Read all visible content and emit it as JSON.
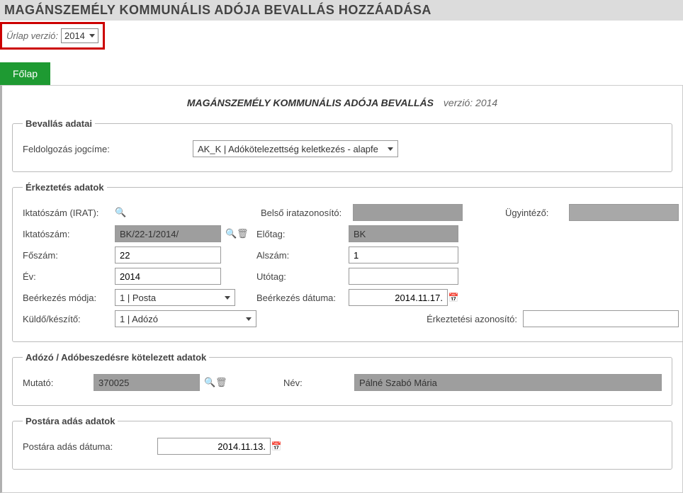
{
  "header": {
    "title": "MAGÁNSZEMÉLY KOMMUNÁLIS ADÓJA BEVALLÁS HOZZÁADÁSA"
  },
  "version": {
    "label": "Űrlap verzió:",
    "value": "2014"
  },
  "tab": {
    "main": "Főlap"
  },
  "formTitle": {
    "bold": "MAGÁNSZEMÉLY KOMMUNÁLIS ADÓJA BEVALLÁS",
    "muted": "verzió: 2014"
  },
  "bevallas": {
    "legend": "Bevallás adatai",
    "jogcim_label": "Feldolgozás jogcíme:",
    "jogcim_value": "AK_K | Adókötelezettség keletkezés - alapfe"
  },
  "erkeztetes": {
    "legend": "Érkeztetés adatok",
    "iktatoszam_irat_label": "Iktatószám (IRAT):",
    "belso_label": "Belső iratazonosító:",
    "ugyintezo_label": "Ügyintéző:",
    "iktatoszam_label": "Iktatószám:",
    "iktatoszam_value": "BK/22-1/2014/",
    "elotag_label": "Előtag:",
    "elotag_value": "BK",
    "foszam_label": "Főszám:",
    "foszam_value": "22",
    "alszam_label": "Alszám:",
    "alszam_value": "1",
    "ev_label": "Év:",
    "ev_value": "2014",
    "utotag_label": "Utótag:",
    "utotag_value": "",
    "beerkezes_mod_label": "Beérkezés módja:",
    "beerkezes_mod_value": "1 | Posta",
    "beerkezes_dat_label": "Beérkezés dátuma:",
    "beerkezes_dat_value": "2014.11.17.",
    "kuldo_label": "Küldő/készítő:",
    "kuldo_value": "1 | Adózó",
    "erkezt_azon_label": "Érkeztetési azonosító:",
    "erkezt_azon_value": ""
  },
  "adozo": {
    "legend": "Adózó / Adóbeszedésre kötelezett adatok",
    "mutato_label": "Mutató:",
    "mutato_value": "370025",
    "nev_label": "Név:",
    "nev_value": "Pálné Szabó Mária"
  },
  "posta": {
    "legend": "Postára adás adatok",
    "datum_label": "Postára adás dátuma:",
    "datum_value": "2014.11.13."
  }
}
